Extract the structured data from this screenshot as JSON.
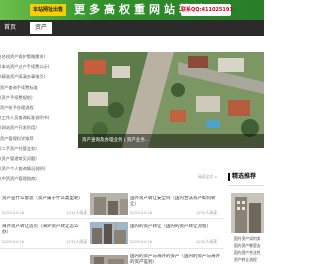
{
  "banner": {
    "badge": "本站网址出售",
    "text": "更多高权重网站转让",
    "contact": "联系QQ:411025193"
  },
  "nav": {
    "home": "首页",
    "active_tab": "资产"
  },
  "left_list": [
    "(名校资产保护策略需求)",
    "(本站资产过户手续费公示)",
    "(精准资产高清办事指引)",
    "资产查询手续费标准",
    "(资产手续费规划)",
    "资产给予办理流程",
    "(工作人员查询标准说明书)",
    "(网站资产开发利用)",
    "资产管理科学推荐",
    "(二手资产托管业务)",
    "(资产管理常见问题)",
    "(资产个人查询情况说明)",
    "(中资资产管理指南)"
  ],
  "hero": {
    "caption": "资产查询及办理业务 | 资产业务..."
  },
  "articles": [
    {
      "title": "资产是什么意思（资产属于什么类型呢）",
      "date": "2023-04-16",
      "stat": "1232人阅读"
    },
    {
      "title": "国外资产转让安全吗（国内合法资产如何转让）",
      "date": "2023-04-16",
      "stat": "1232人阅读",
      "tag": "阅读全文 >"
    },
    {
      "title": "海外资产转让首页（海外资产转让怎么办）",
      "date": "2023-04-16",
      "stat": "1232人阅读"
    },
    {
      "title": "国内的资产转让（国内的资产转让流程）",
      "date": "2023-04-16",
      "stat": "1232人阅读"
    },
    {
      "title": "国内的资产与海外的资产（国内的资产与海外的资产差别）",
      "date": "2023-04-16",
      "stat": "1232人阅读"
    }
  ],
  "sidebar": {
    "title": "精选推荐",
    "items": [
      "国外资产如何卖",
      "国内资产哪里去",
      "国内资产合法性",
      "资产转让流程"
    ]
  },
  "colors": {
    "banner_green": "#2f8f2b",
    "badge_yellow": "#f4d000",
    "contact_red": "#d0021b",
    "nav_dark": "#2b2b2b"
  }
}
